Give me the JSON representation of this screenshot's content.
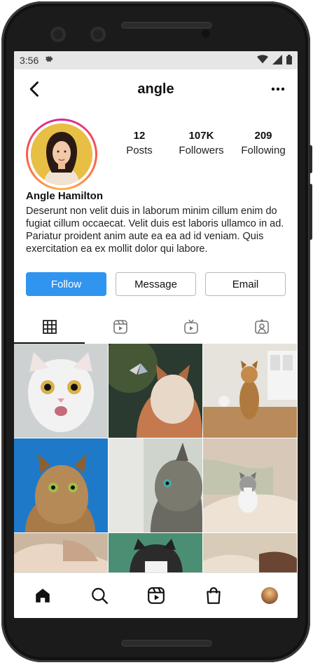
{
  "statusbar": {
    "time": "3:56",
    "icons": [
      "settings-icon",
      "wifi-icon",
      "cellular-icon",
      "battery-icon"
    ]
  },
  "header": {
    "title": "angle",
    "back_icon": "chevron-left-icon",
    "more_icon": "ellipsis-icon"
  },
  "profile": {
    "stats": [
      {
        "value": "12",
        "label": "Posts"
      },
      {
        "value": "107K",
        "label": "Followers"
      },
      {
        "value": "209",
        "label": "Following"
      }
    ],
    "name": "Angle Hamilton",
    "bio": "Deserunt non velit duis in laborum minim cillum enim do fugiat cillum occaecat. Velit duis est laboris ullamco in ad. Pariatur proident anim aute ea ea ad id veniam. Quis exercitation ea ex mollit dolor qui labore."
  },
  "actions": {
    "follow": "Follow",
    "message": "Message",
    "email": "Email"
  },
  "tabs": [
    {
      "icon": "grid-icon",
      "active": true
    },
    {
      "icon": "reels-icon",
      "active": false
    },
    {
      "icon": "igtv-icon",
      "active": false
    },
    {
      "icon": "tagged-icon",
      "active": false
    }
  ],
  "grid_posts": [
    "white-cat-photo",
    "cat-with-butterfly-photo",
    "cat-on-table-photo",
    "tabby-cat-blue-sky-photo",
    "tabby-cat-profile-photo",
    "kitten-on-blanket-photo",
    "cat-partial-photo-1",
    "cat-partial-photo-2",
    "cat-partial-photo-3"
  ],
  "bottom_nav": [
    {
      "icon": "home-icon",
      "active": true
    },
    {
      "icon": "search-icon",
      "active": false
    },
    {
      "icon": "reels-icon",
      "active": false
    },
    {
      "icon": "shop-icon",
      "active": false
    },
    {
      "icon": "profile-avatar",
      "active": false
    }
  ],
  "colors": {
    "follow_button": "#3095ef",
    "status_bar": "#e6e6e6",
    "avatar_ring": [
      "#d6249f",
      "#fd5949",
      "#fdb24a"
    ]
  }
}
